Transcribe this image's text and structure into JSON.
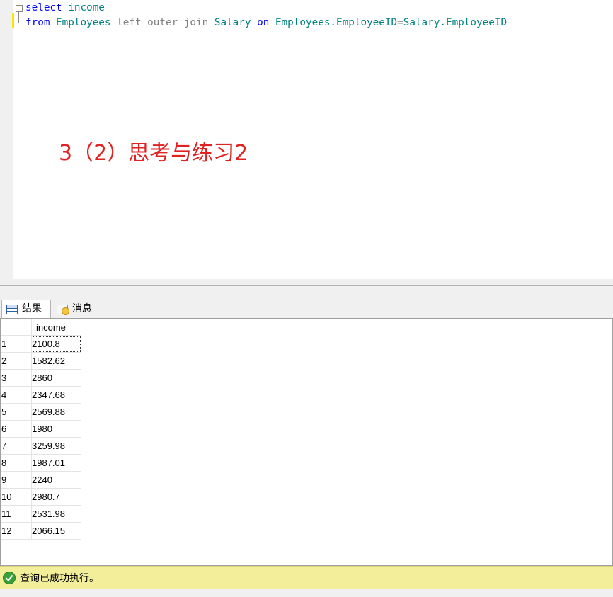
{
  "editor": {
    "line1": {
      "kw": "select",
      "sp": " ",
      "col": "income"
    },
    "line2": {
      "kw_from": "from",
      "sp1": " ",
      "table1": "Employees",
      "sp2": " ",
      "join": "left outer join",
      "sp3": " ",
      "table2": "Salary",
      "sp4": " ",
      "kw_on": "on",
      "sp5": " ",
      "cond_left": "Employees.EmployeeID",
      "eq": "=",
      "cond_right": "Salary.EmployeeID"
    }
  },
  "annotation": {
    "text": "3（2）思考与练习2"
  },
  "tabs": {
    "results": "结果",
    "messages": "消息"
  },
  "results": {
    "columns": [
      "income"
    ],
    "rows": [
      {
        "n": "1",
        "income": "2100.8"
      },
      {
        "n": "2",
        "income": "1582.62"
      },
      {
        "n": "3",
        "income": "2860"
      },
      {
        "n": "4",
        "income": "2347.68"
      },
      {
        "n": "5",
        "income": "2569.88"
      },
      {
        "n": "6",
        "income": "1980"
      },
      {
        "n": "7",
        "income": "3259.98"
      },
      {
        "n": "8",
        "income": "1987.01"
      },
      {
        "n": "9",
        "income": "2240"
      },
      {
        "n": "10",
        "income": "2980.7"
      },
      {
        "n": "11",
        "income": "2531.98"
      },
      {
        "n": "12",
        "income": "2066.15"
      }
    ]
  },
  "status": {
    "text": "查询已成功执行。",
    "color": "#f3ee99"
  },
  "icons": {
    "results_tab": "grid-icon",
    "messages_tab": "message-icon",
    "status": "success-check-icon",
    "collapse": "collapse-minus-icon"
  }
}
